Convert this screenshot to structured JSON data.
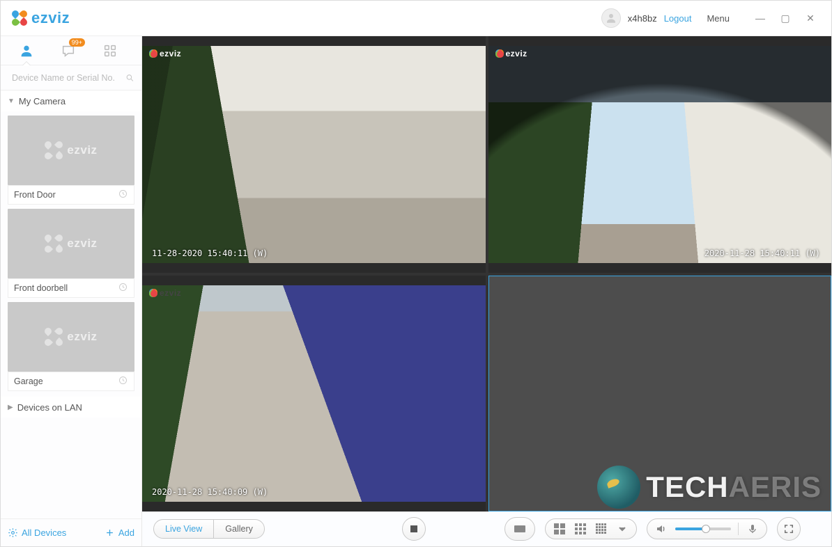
{
  "header": {
    "brand": "ezviz",
    "username": "x4h8bz",
    "logout": "Logout",
    "menu": "Menu"
  },
  "sidebar": {
    "search_placeholder": "Device Name or Serial No.",
    "badge": "99+",
    "group_my_camera": "My Camera",
    "group_lan": "Devices on LAN",
    "cameras": [
      {
        "label": "Front Door"
      },
      {
        "label": "Front doorbell"
      },
      {
        "label": "Garage"
      }
    ],
    "thumb_brand": "ezviz",
    "footer_all": "All Devices",
    "footer_add": "Add"
  },
  "video": {
    "watermark": "ezviz",
    "cells": [
      {
        "timestamp": "11-28-2020 15:40:11 (W)",
        "ts_side": "left"
      },
      {
        "timestamp": "2020-11-28 15:40:11 (W)",
        "ts_side": "right"
      },
      {
        "timestamp": "2020-11-28 15:40:09 (W)",
        "ts_side": "left"
      },
      {
        "timestamp": ""
      }
    ]
  },
  "toolbar": {
    "live_view": "Live View",
    "gallery": "Gallery",
    "volume_pct": 55
  },
  "overlay": {
    "brand_main": "TECH",
    "brand_rest": "AERIS"
  }
}
